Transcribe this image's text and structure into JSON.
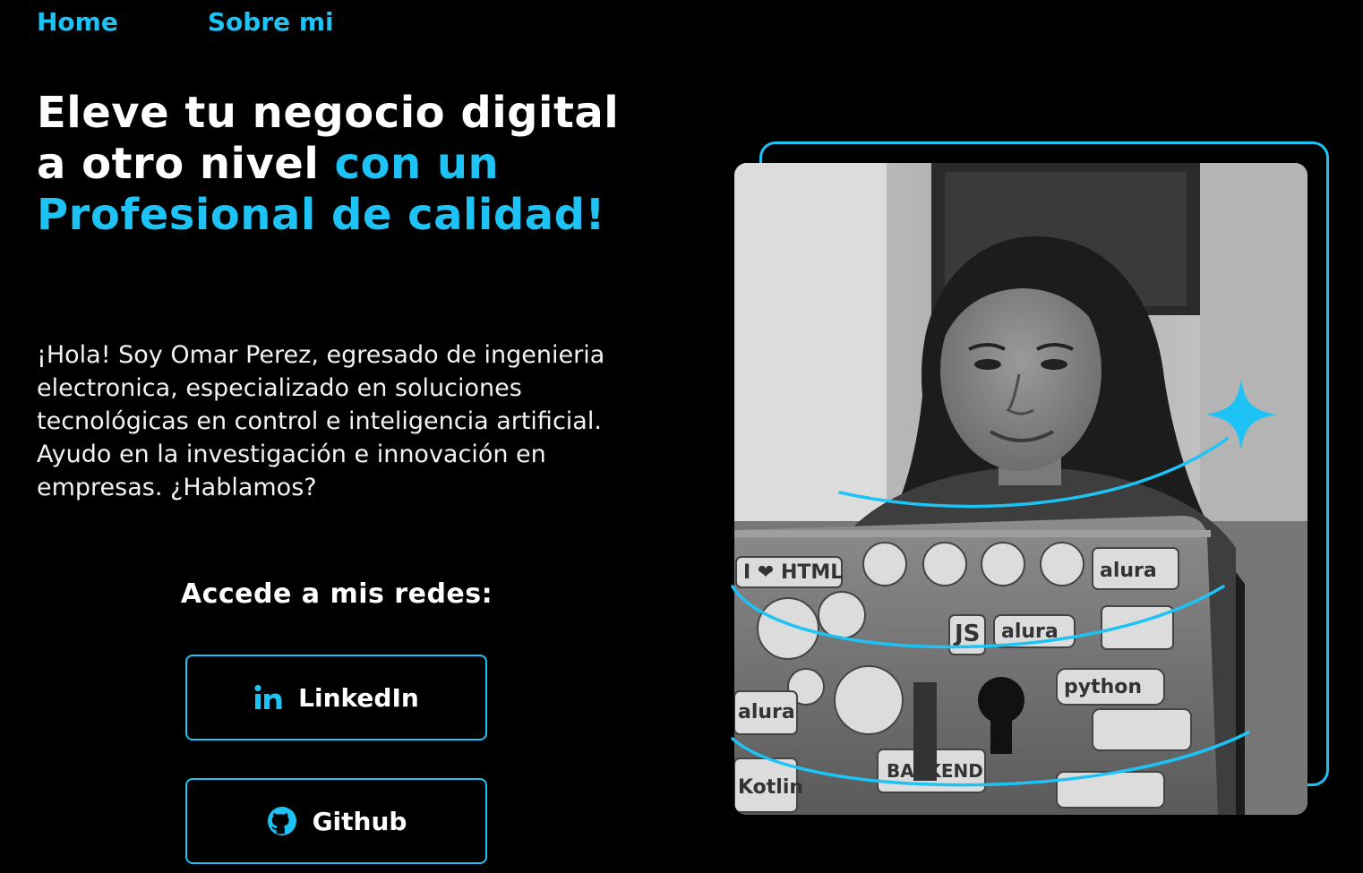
{
  "nav": {
    "home": "Home",
    "about": "Sobre mi"
  },
  "hero": {
    "headline_plain": "Eleve tu negocio digital a otro nivel ",
    "headline_accent": "con un Profesional de calidad!",
    "bio": "¡Hola! Soy Omar Perez, egresado de ingenieria electronica, especializado en soluciones tecnológicas en control e inteligencia artificial. Ayudo en la investigación e innovación en empresas. ¿Hablamos?",
    "social_title": "Accede a mis redes:",
    "buttons": {
      "linkedin": "LinkedIn",
      "github": "Github"
    },
    "laptop_stickers": [
      "I ❤ HTML",
      "alura",
      "JS",
      "alura",
      "python",
      "BACKEND",
      "alura",
      "Kotlin"
    ]
  },
  "colors": {
    "background": "#000000",
    "accent": "#1ec3f5",
    "text": "#ffffff"
  },
  "icons": {
    "linkedin": "linkedin-icon",
    "github": "github-icon",
    "sparkle": "sparkle-star-icon"
  }
}
